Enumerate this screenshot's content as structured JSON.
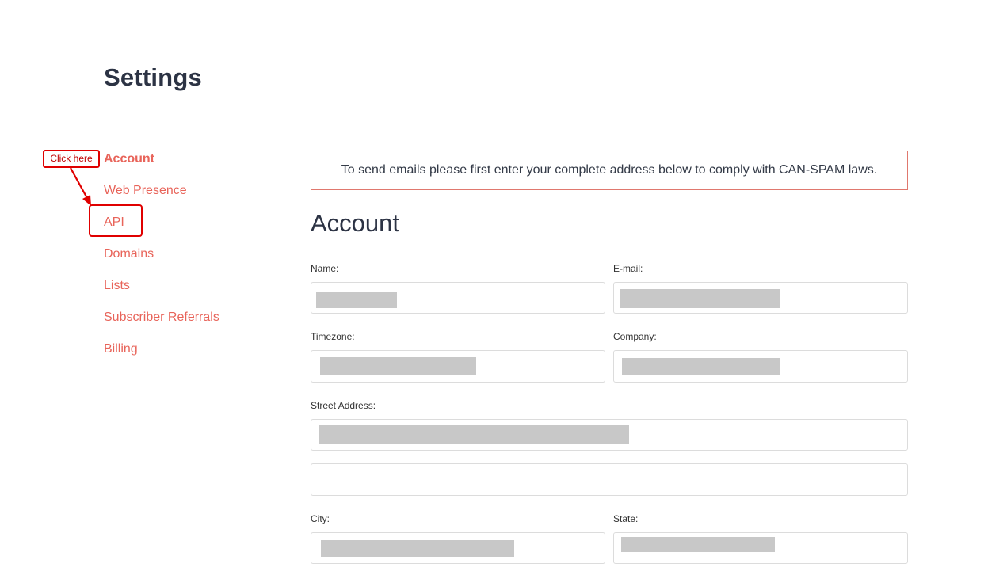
{
  "header": {
    "title": "Settings"
  },
  "sidebar": {
    "items": [
      {
        "label": "Account",
        "active": true
      },
      {
        "label": "Web Presence"
      },
      {
        "label": "API"
      },
      {
        "label": "Domains"
      },
      {
        "label": "Lists"
      },
      {
        "label": "Subscriber Referrals"
      },
      {
        "label": "Billing"
      }
    ]
  },
  "annotation": {
    "callout": "Click here",
    "color": "#e00000"
  },
  "main": {
    "notice": "To send emails please first enter your complete address below to comply with CAN-SPAM laws.",
    "section_title": "Account",
    "fields": {
      "name": {
        "label": "Name:"
      },
      "email": {
        "label": "E-mail:"
      },
      "timezone": {
        "label": "Timezone:"
      },
      "company": {
        "label": "Company:"
      },
      "street": {
        "label": "Street Address:"
      },
      "city": {
        "label": "City:"
      },
      "state": {
        "label": "State:"
      }
    }
  },
  "colors": {
    "accent": "#e8645a",
    "heading": "#2c3344",
    "notice_border": "#e0786e",
    "redaction": "#c8c8c8"
  }
}
